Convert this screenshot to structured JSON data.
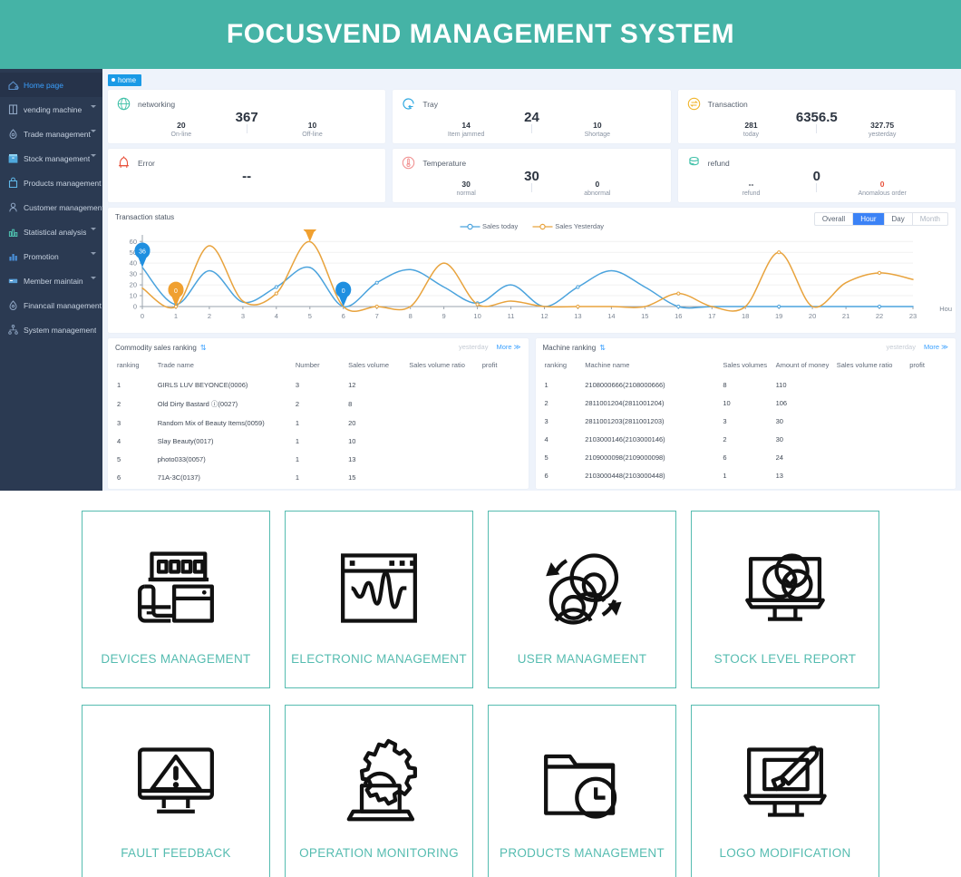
{
  "header": {
    "title": "FOCUSVEND MANAGEMENT SYSTEM",
    "bg": "#45b3a6"
  },
  "sidebar": {
    "items": [
      {
        "label": "Home page",
        "icon": "home-icon",
        "active": true,
        "caret": false
      },
      {
        "label": "vending machine",
        "icon": "vending-machine-icon",
        "active": false,
        "caret": true
      },
      {
        "label": "Trade management",
        "icon": "trade-icon",
        "active": false,
        "caret": true
      },
      {
        "label": "Stock management",
        "icon": "stock-icon",
        "active": false,
        "caret": true
      },
      {
        "label": "Products management",
        "icon": "products-icon",
        "active": false,
        "caret": false
      },
      {
        "label": "Customer management",
        "icon": "customer-icon",
        "active": false,
        "caret": false
      },
      {
        "label": "Statistical analysis",
        "icon": "statistics-icon",
        "active": false,
        "caret": true
      },
      {
        "label": "Promotion",
        "icon": "promotion-icon",
        "active": false,
        "caret": true
      },
      {
        "label": "Member maintain",
        "icon": "member-icon",
        "active": false,
        "caret": true
      },
      {
        "label": "Financail management",
        "icon": "finance-icon",
        "active": false,
        "caret": false
      },
      {
        "label": "System management",
        "icon": "system-icon",
        "active": false,
        "caret": false
      }
    ]
  },
  "tabs": [
    {
      "label": "home",
      "active": true
    }
  ],
  "cards": [
    {
      "title": "networking",
      "icon": "globe-icon",
      "accent": "#3fc0a8",
      "big": "367",
      "feet": [
        {
          "value": "20",
          "label": "On-line",
          "red": false
        },
        {
          "value": "10",
          "label": "Off-line",
          "red": false
        }
      ]
    },
    {
      "title": "Tray",
      "icon": "tray-icon",
      "accent": "#2ea7e0",
      "big": "24",
      "feet": [
        {
          "value": "14",
          "label": "Item jammed",
          "red": false
        },
        {
          "value": "10",
          "label": "Shortage",
          "red": false
        }
      ]
    },
    {
      "title": "Transaction",
      "icon": "transaction-icon",
      "accent": "#f0b429",
      "big": "6356.5",
      "feet": [
        {
          "value": "281",
          "label": "today",
          "red": false
        },
        {
          "value": "327.75",
          "label": "yesterday",
          "red": false
        }
      ]
    },
    {
      "title": "Error",
      "icon": "error-icon",
      "accent": "#e8503a",
      "big": "--",
      "feet": []
    },
    {
      "title": "Temperature",
      "icon": "temperature-icon",
      "accent": "#f08a8a",
      "big": "30",
      "feet": [
        {
          "value": "30",
          "label": "normal",
          "red": false
        },
        {
          "value": "0",
          "label": "abnormal",
          "red": false
        }
      ]
    },
    {
      "title": "refund",
      "icon": "refund-icon",
      "accent": "#3fc0a8",
      "big": "0",
      "feet": [
        {
          "value": "--",
          "label": "refund",
          "red": false
        },
        {
          "value": "0",
          "label": "Anomalous order",
          "red": true
        }
      ]
    }
  ],
  "chart_panel": {
    "title": "Transaction status",
    "segments": [
      {
        "label": "Overall",
        "active": false,
        "disabled": false
      },
      {
        "label": "Hour",
        "active": true,
        "disabled": false
      },
      {
        "label": "Day",
        "active": false,
        "disabled": false
      },
      {
        "label": "Month",
        "active": false,
        "disabled": true
      }
    ],
    "x_axis_unit": "Hou"
  },
  "chart_data": {
    "type": "line",
    "title": "Transaction status",
    "xlabel": "Hou",
    "ylabel": "",
    "x": [
      0,
      1,
      2,
      3,
      4,
      5,
      6,
      7,
      8,
      9,
      10,
      11,
      12,
      13,
      14,
      15,
      16,
      17,
      18,
      19,
      20,
      21,
      22,
      23
    ],
    "xticks": [
      "0",
      "1",
      "2",
      "3",
      "4",
      "5",
      "6",
      "7",
      "8",
      "9",
      "10",
      "11",
      "12",
      "13",
      "14",
      "15",
      "16",
      "17",
      "18",
      "19",
      "20",
      "21",
      "22",
      "23"
    ],
    "yticks": [
      0,
      10,
      20,
      30,
      40,
      50,
      60
    ],
    "ylim": [
      0,
      66
    ],
    "grid": true,
    "legend": [
      "Sales today",
      "Sales Yesterday"
    ],
    "legend_position": "top-center",
    "series": [
      {
        "name": "Sales today",
        "color": "#4ba3dd",
        "values": [
          36,
          2,
          33,
          4,
          18,
          36,
          0,
          22,
          34,
          18,
          3,
          20,
          0,
          18,
          33,
          18,
          0,
          0,
          0,
          0,
          0,
          0,
          0,
          0
        ]
      },
      {
        "name": "Sales Yesterday",
        "color": "#e8a33d",
        "values": [
          17,
          0,
          56,
          5,
          12,
          59.75,
          0,
          0,
          0,
          40,
          2,
          5,
          0,
          0,
          0,
          0,
          12,
          0,
          0,
          50,
          0,
          22,
          31,
          25
        ]
      }
    ],
    "annotations": [
      {
        "x": 0,
        "y": 36,
        "text": "36",
        "color": "#1f8fe0",
        "series": "Sales today"
      },
      {
        "x": 1,
        "y": 0,
        "text": "0",
        "color": "#f0a030",
        "series": "Sales Yesterday"
      },
      {
        "x": 5,
        "y": 59.75,
        "text": "59.75",
        "color": "#f0a030",
        "series": "Sales Yesterday"
      },
      {
        "x": 6,
        "y": 0,
        "text": "0",
        "color": "#1f8fe0",
        "series": "Sales today"
      }
    ]
  },
  "commodity_panel": {
    "title": "Commodity sales ranking",
    "yesterday_label": "yesterday",
    "more_label": "More ≫",
    "columns": [
      "ranking",
      "Trade name",
      "Number",
      "Sales volume",
      "Sales volume ratio",
      "profit"
    ],
    "rows": [
      {
        "ranking": "1",
        "name": "GIRLS LUV BEYONCE(0006)",
        "number": "3",
        "volume": "12",
        "ratio": "",
        "profit": ""
      },
      {
        "ranking": "2",
        "name": "Old Dirty Bastard ⓘ(0027)",
        "number": "2",
        "volume": "8",
        "ratio": "",
        "profit": ""
      },
      {
        "ranking": "3",
        "name": "Random Mix of Beauty Items(0059)",
        "number": "1",
        "volume": "20",
        "ratio": "",
        "profit": ""
      },
      {
        "ranking": "4",
        "name": "Slay Beauty(0017)",
        "number": "1",
        "volume": "10",
        "ratio": "",
        "profit": ""
      },
      {
        "ranking": "5",
        "name": "photo033(0057)",
        "number": "1",
        "volume": "13",
        "ratio": "",
        "profit": ""
      },
      {
        "ranking": "6",
        "name": "71A-3C(0137)",
        "number": "1",
        "volume": "15",
        "ratio": "",
        "profit": ""
      }
    ]
  },
  "machine_panel": {
    "title": "Machine ranking",
    "yesterday_label": "yesterday",
    "more_label": "More ≫",
    "columns": [
      "ranking",
      "Machine name",
      "Sales volumes",
      "Amount of money",
      "Sales volume ratio",
      "profit"
    ],
    "rows": [
      {
        "ranking": "1",
        "name": "2108000666(2108000666)",
        "volumes": "8",
        "amount": "110",
        "ratio": "",
        "profit": ""
      },
      {
        "ranking": "2",
        "name": "2811001204(2811001204)",
        "volumes": "10",
        "amount": "106",
        "ratio": "",
        "profit": ""
      },
      {
        "ranking": "3",
        "name": "2811001203(2811001203)",
        "volumes": "3",
        "amount": "30",
        "ratio": "",
        "profit": ""
      },
      {
        "ranking": "4",
        "name": "2103000146(2103000146)",
        "volumes": "2",
        "amount": "30",
        "ratio": "",
        "profit": ""
      },
      {
        "ranking": "5",
        "name": "2109000098(2109000098)",
        "volumes": "6",
        "amount": "24",
        "ratio": "",
        "profit": ""
      },
      {
        "ranking": "6",
        "name": "2103000448(2103000448)",
        "volumes": "1",
        "amount": "13",
        "ratio": "",
        "profit": ""
      }
    ]
  },
  "features": {
    "accent": "#55bcb0",
    "items": [
      {
        "label": "DEVICES MANAGEMENT",
        "icon": "devices-icon"
      },
      {
        "label": "ELECTRONIC MANAGEMENT",
        "icon": "electronic-waveform-icon"
      },
      {
        "label": "USER MANAGMEENT",
        "icon": "users-icon"
      },
      {
        "label": "STOCK LEVEL REPORT",
        "icon": "stock-report-monitor-icon"
      },
      {
        "label": "FAULT FEEDBACK",
        "icon": "fault-warning-monitor-icon"
      },
      {
        "label": "OPERATION MONITORING",
        "icon": "gear-laptop-icon"
      },
      {
        "label": "PRODUCTS MANAGEMENT",
        "icon": "folder-clock-icon"
      },
      {
        "label": "LOGO MODIFICATION",
        "icon": "monitor-brush-icon"
      }
    ]
  }
}
